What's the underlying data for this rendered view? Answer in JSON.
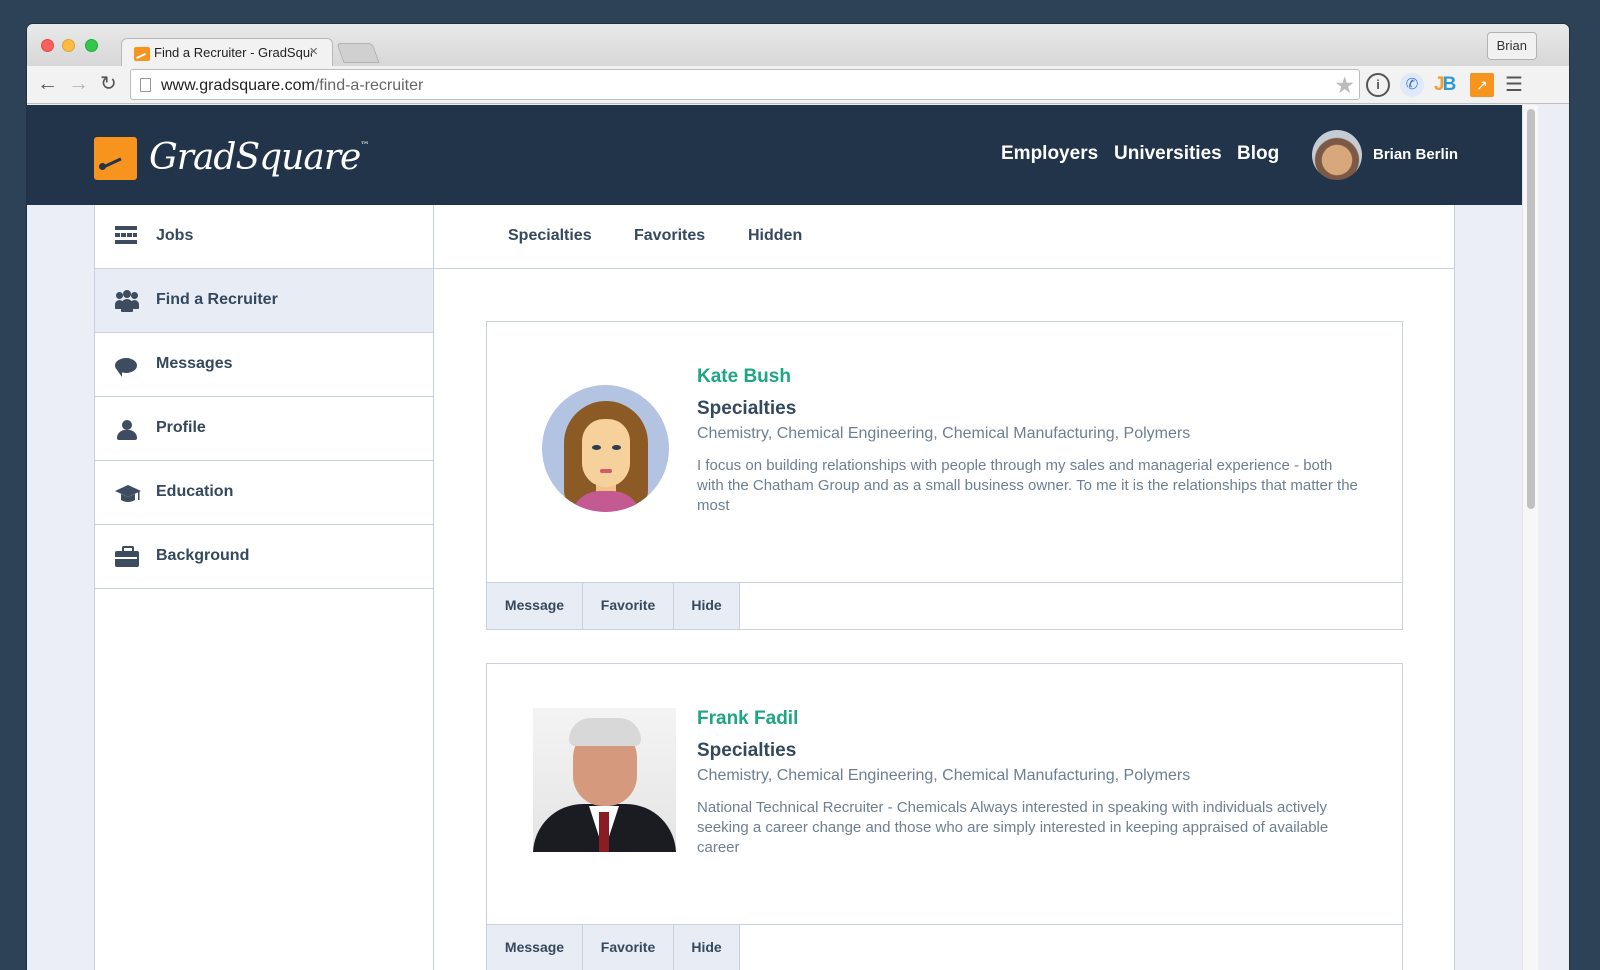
{
  "browser": {
    "tab_title": "Find a Recruiter - GradSquare",
    "tab_close": "×",
    "profile_button": "Brian",
    "url_host": "www.gradsquare.com",
    "url_path": "/find-a-recruiter",
    "icons": [
      "back-arrow-icon",
      "forward-arrow-icon",
      "reload-icon",
      "page-icon",
      "bookmark-star-icon",
      "onepassword-icon",
      "phone-extension-icon",
      "jb-extension-icon",
      "analytics-extension-icon",
      "menu-icon"
    ]
  },
  "header": {
    "logo_text": "GradSquare",
    "logo_tm": "™",
    "nav": {
      "employers": "Employers",
      "universities": "Universities",
      "blog": "Blog"
    },
    "user_name": "Brian Berlin",
    "bg_color": "#21344a",
    "logo_color": "#f7941d"
  },
  "sidebar": {
    "items": [
      {
        "label": "Jobs",
        "icon": "jobs-list-icon"
      },
      {
        "label": "Find a Recruiter",
        "icon": "people-icon",
        "active": true
      },
      {
        "label": "Messages",
        "icon": "chat-bubble-icon"
      },
      {
        "label": "Profile",
        "icon": "user-icon"
      },
      {
        "label": "Education",
        "icon": "graduation-cap-icon"
      },
      {
        "label": "Background",
        "icon": "briefcase-icon"
      }
    ]
  },
  "subnav": {
    "specialties": "Specialties",
    "favorites": "Favorites",
    "hidden": "Hidden"
  },
  "recruiters": [
    {
      "name": "Kate Bush",
      "specialties_title": "Specialties",
      "specialties": "Chemistry, Chemical Engineering, Chemical Manufacturing, Polymers",
      "bio": "I focus on building relationships with people through my sales and managerial experience - both with the Chatham Group and as a small business owner. To me it is the relationships that matter the most",
      "actions": {
        "message": "Message",
        "favorite": "Favorite",
        "hide": "Hide"
      }
    },
    {
      "name": "Frank Fadil",
      "specialties_title": "Specialties",
      "specialties": "Chemistry, Chemical Engineering, Chemical Manufacturing, Polymers",
      "bio": "National Technical Recruiter - Chemicals Always interested in speaking with individuals actively seeking a career change and those who are simply interested in keeping appraised of available career",
      "actions": {
        "message": "Message",
        "favorite": "Favorite",
        "hide": "Hide"
      }
    }
  ],
  "colors": {
    "accent_green": "#1da683",
    "text_dark": "#34495e",
    "text_muted": "#6e7f91"
  }
}
